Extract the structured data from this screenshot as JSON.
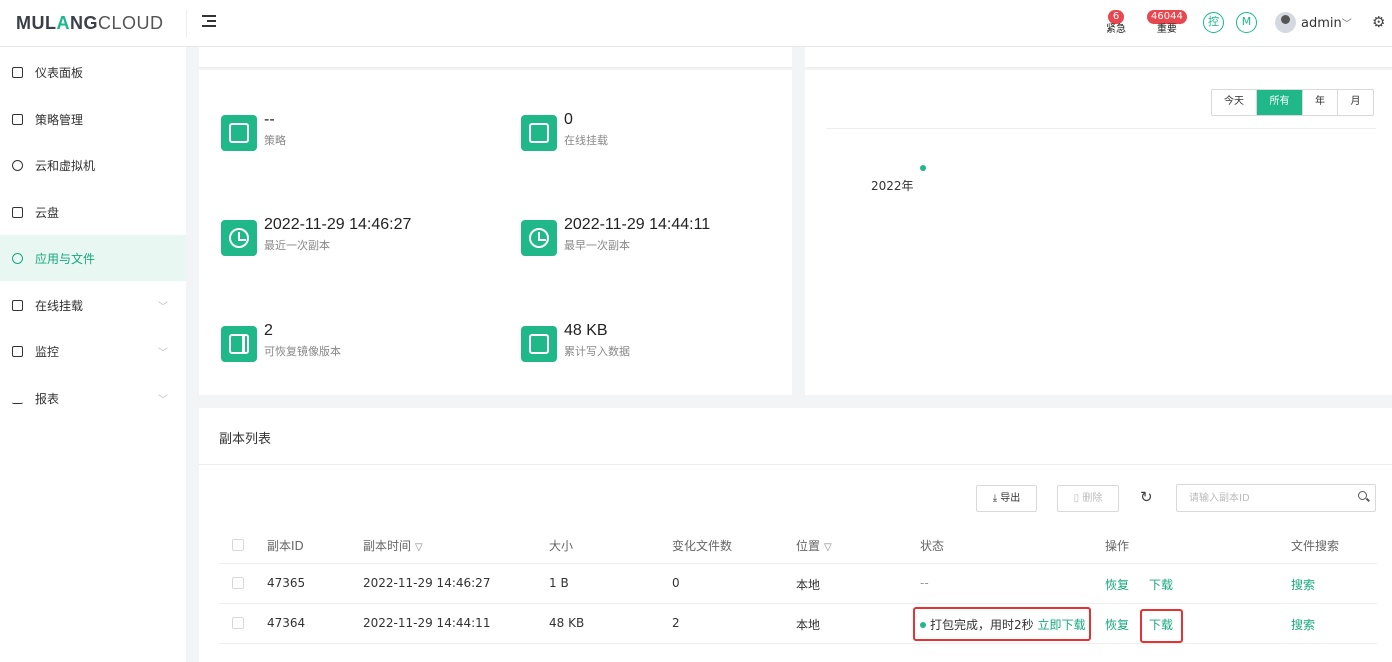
{
  "header": {
    "logo_bold_1": "MUL",
    "logo_star": "A",
    "logo_bold_2": "NG",
    "logo_light": "CLOUD",
    "urgent_count": "6",
    "urgent_label": "紧急",
    "important_count": "46044",
    "important_label": "重要",
    "icon_kong": "控",
    "icon_m": "M",
    "user": "admin",
    "user_caret": "﹀"
  },
  "sidebar": {
    "items": [
      {
        "label": "仪表面板"
      },
      {
        "label": "策略管理"
      },
      {
        "label": "云和虚拟机"
      },
      {
        "label": "云盘"
      },
      {
        "label": "应用与文件"
      },
      {
        "label": "在线挂载"
      },
      {
        "label": "监控"
      },
      {
        "label": "报表"
      }
    ]
  },
  "stats": [
    {
      "value": "--",
      "label": "策略"
    },
    {
      "value": "0",
      "label": "在线挂载"
    },
    {
      "value": "2022-11-29 14:46:27",
      "label": "最近一次副本"
    },
    {
      "value": "2022-11-29 14:44:11",
      "label": "最早一次副本"
    },
    {
      "value": "2",
      "label": "可恢复镜像版本"
    },
    {
      "value": "48 KB",
      "label": "累计写入数据"
    }
  ],
  "range": {
    "today": "今天",
    "all": "所有",
    "year": "年",
    "month": "月"
  },
  "chart_data": {
    "type": "scatter",
    "x": [
      "2022年"
    ],
    "values": [
      1
    ]
  },
  "list": {
    "title": "副本列表",
    "export": "导出",
    "delete": "删除",
    "search_placeholder": "请输入副本ID",
    "columns": {
      "id": "副本ID",
      "time": "副本时间",
      "size": "大小",
      "changed": "变化文件数",
      "location": "位置",
      "status": "状态",
      "actions": "操作",
      "search": "文件搜索"
    },
    "rows": [
      {
        "id": "47365",
        "time": "2022-11-29 14:46:27",
        "size": "1 B",
        "changed": "0",
        "location": "本地",
        "status": "--",
        "status_link": "",
        "restore": "恢复",
        "download": "下载",
        "search": "搜索"
      },
      {
        "id": "47364",
        "time": "2022-11-29 14:44:11",
        "size": "48 KB",
        "changed": "2",
        "location": "本地",
        "status": "打包完成，用时2秒",
        "status_link": "立即下载",
        "restore": "恢复",
        "download": "下载",
        "search": "搜索"
      }
    ]
  }
}
